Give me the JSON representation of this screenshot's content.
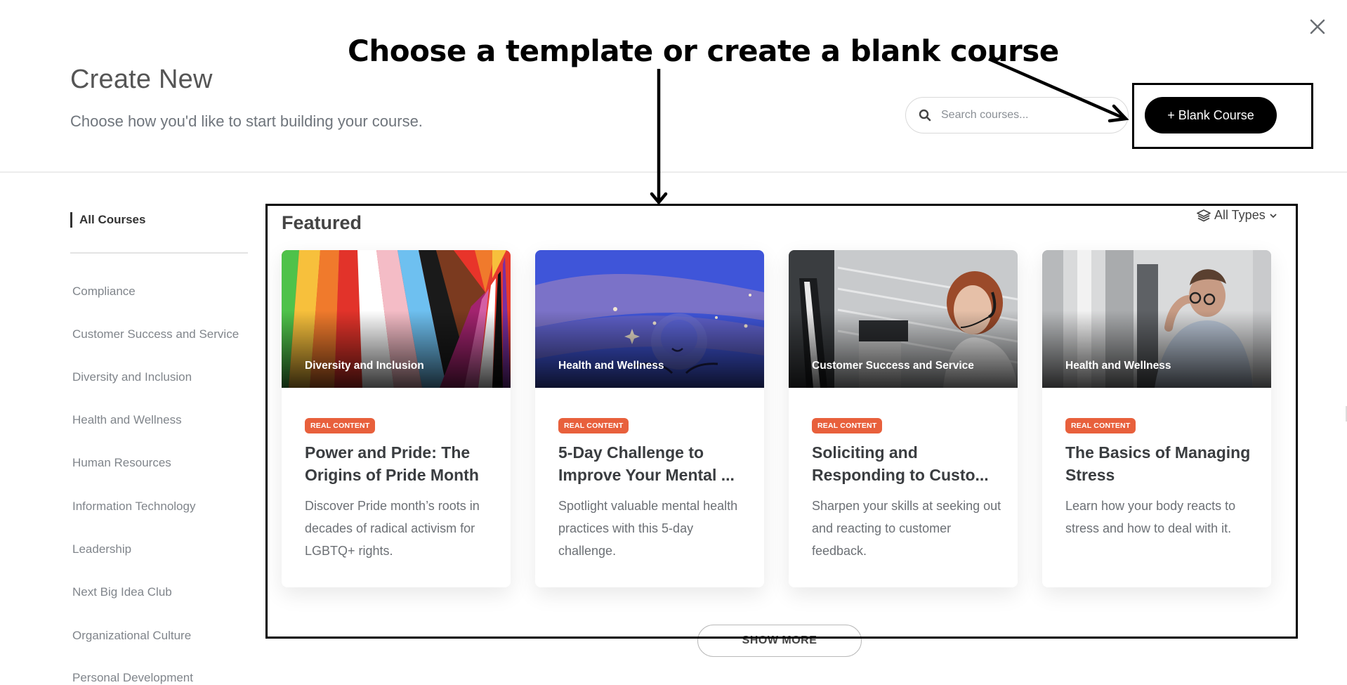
{
  "header": {
    "title": "Create New",
    "subtitle": "Choose how you'd like to start building your course.",
    "close_icon": "close-icon"
  },
  "search": {
    "placeholder": "Search courses...",
    "value": "",
    "icon": "search-icon"
  },
  "blank_course_button": {
    "label": "+ Blank Course"
  },
  "annotation": {
    "text": "Choose a template or create a blank course",
    "color": "#000000"
  },
  "sidebar": {
    "active": "All Courses",
    "items": [
      {
        "label": "Compliance"
      },
      {
        "label": "Customer Success and Service"
      },
      {
        "label": "Diversity and Inclusion"
      },
      {
        "label": "Health and Wellness"
      },
      {
        "label": "Human Resources"
      },
      {
        "label": "Information Technology"
      },
      {
        "label": "Leadership"
      },
      {
        "label": "Next Big Idea Club"
      },
      {
        "label": "Organizational Culture"
      },
      {
        "label": "Personal Development"
      }
    ]
  },
  "featured": {
    "title": "Featured",
    "filter_label": "All Types",
    "filter_icon": "layers-icon",
    "cards": [
      {
        "category": "Diversity and Inclusion",
        "badge": "REAL CONTENT",
        "title": "Power and Pride: The Origins of Pride Month",
        "description": "Discover Pride month’s roots in decades of radical activism for LGBTQ+ rights."
      },
      {
        "category": "Health and Wellness",
        "badge": "REAL CONTENT",
        "title": "5-Day Challenge to Improve Your Mental ...",
        "description": "Spotlight valuable mental health practices with this 5-day challenge."
      },
      {
        "category": "Customer Success and Service",
        "badge": "REAL CONTENT",
        "title": "Soliciting and Responding to Custo...",
        "description": "Sharpen your skills at seeking out and reacting to customer feedback."
      },
      {
        "category": "Health and Wellness",
        "badge": "REAL CONTENT",
        "title": "The Basics of Managing Stress",
        "description": "Learn how your body reacts to stress and how to deal with it."
      }
    ],
    "show_more_label": "SHOW MORE"
  },
  "colors": {
    "badge": "#e8603c",
    "primary_button": "#000000",
    "sidebar_text": "#80858b"
  }
}
